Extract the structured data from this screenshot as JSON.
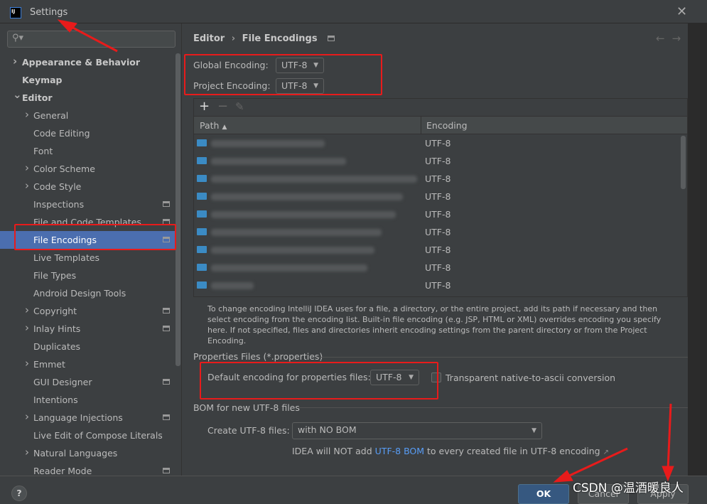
{
  "window": {
    "title": "Settings",
    "logo": "IJ"
  },
  "search": {
    "placeholder": ""
  },
  "sidebar": {
    "items": [
      {
        "label": "Appearance & Behavior",
        "level": 0,
        "chevron": "right",
        "bold": true
      },
      {
        "label": "Keymap",
        "level": 0,
        "bold": true
      },
      {
        "label": "Editor",
        "level": 0,
        "chevron": "down",
        "bold": true
      },
      {
        "label": "General",
        "level": 1,
        "chevron": "right"
      },
      {
        "label": "Code Editing",
        "level": 1
      },
      {
        "label": "Font",
        "level": 1
      },
      {
        "label": "Color Scheme",
        "level": 1,
        "chevron": "right"
      },
      {
        "label": "Code Style",
        "level": 1,
        "chevron": "right"
      },
      {
        "label": "Inspections",
        "level": 1,
        "modified": true
      },
      {
        "label": "File and Code Templates",
        "level": 1,
        "modified": true
      },
      {
        "label": "File Encodings",
        "level": 1,
        "modified": true,
        "selected": true
      },
      {
        "label": "Live Templates",
        "level": 1
      },
      {
        "label": "File Types",
        "level": 1
      },
      {
        "label": "Android Design Tools",
        "level": 1
      },
      {
        "label": "Copyright",
        "level": 1,
        "chevron": "right",
        "modified": true
      },
      {
        "label": "Inlay Hints",
        "level": 1,
        "chevron": "right",
        "modified": true
      },
      {
        "label": "Duplicates",
        "level": 1
      },
      {
        "label": "Emmet",
        "level": 1,
        "chevron": "right"
      },
      {
        "label": "GUI Designer",
        "level": 1,
        "modified": true
      },
      {
        "label": "Intentions",
        "level": 1
      },
      {
        "label": "Language Injections",
        "level": 1,
        "chevron": "right",
        "modified": true
      },
      {
        "label": "Live Edit of Compose Literals",
        "level": 1
      },
      {
        "label": "Natural Languages",
        "level": 1,
        "chevron": "right"
      },
      {
        "label": "Reader Mode",
        "level": 1,
        "modified": true
      }
    ]
  },
  "breadcrumb": {
    "parent": "Editor",
    "separator": "›",
    "current": "File Encodings"
  },
  "encodings": {
    "global_label": "Global Encoding:",
    "global_value": "UTF-8",
    "project_label": "Project Encoding:",
    "project_value": "UTF-8"
  },
  "table": {
    "toolbar": {
      "add": "+",
      "remove": "−",
      "edit": "✎"
    },
    "columns": [
      "Path",
      "Encoding"
    ],
    "sort_indicator": "▲",
    "rows": [
      "UTF-8",
      "UTF-8",
      "UTF-8",
      "UTF-8",
      "UTF-8",
      "UTF-8",
      "UTF-8",
      "UTF-8",
      "UTF-8"
    ]
  },
  "description": "To change encoding IntelliJ IDEA uses for a file, a directory, or the entire project, add its path if necessary and then select encoding from the encoding list. Built-in file encoding (e.g. JSP, HTML or XML) overrides encoding you specify here. If not specified, files and directories inherit encoding settings from the parent directory or from the Project Encoding.",
  "properties": {
    "section": "Properties Files (*.properties)",
    "default_label": "Default encoding for properties files:",
    "default_value": "UTF-8",
    "transparent_label": "Transparent native-to-ascii conversion",
    "transparent_checked": false
  },
  "bom": {
    "section": "BOM for new UTF-8 files",
    "create_label": "Create UTF-8 files:",
    "create_value": "with NO BOM",
    "note_before": "IDEA will NOT add ",
    "note_link": "UTF-8 BOM",
    "note_after": " to every created file in UTF-8 encoding",
    "note_icon": "↗"
  },
  "footer": {
    "help": "?",
    "ok": "OK",
    "cancel": "Cancel",
    "apply": "Apply"
  },
  "watermark": "CSDN @温酒暖良人",
  "colors": {
    "accent": "#4b6eaf",
    "link": "#589df6",
    "annotation": "#e81b1b"
  }
}
